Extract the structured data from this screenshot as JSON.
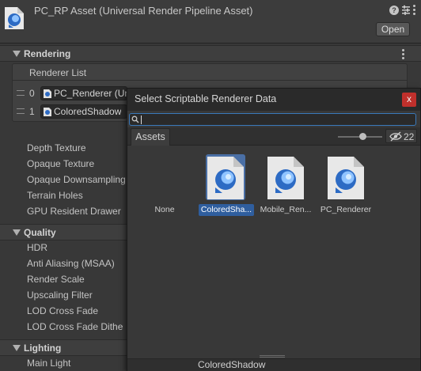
{
  "inspector": {
    "title": "PC_RP Asset (Universal Render Pipeline Asset)",
    "help_icon": "?",
    "open_label": "Open"
  },
  "rendering": {
    "section_label": "Rendering",
    "renderer_list_label": "Renderer List",
    "renderers": [
      {
        "index": "0",
        "name": "PC_Renderer (Un"
      },
      {
        "index": "1",
        "name": "ColoredShadow"
      }
    ],
    "properties": [
      "Depth Texture",
      "Opaque Texture",
      "Opaque Downsampling",
      "Terrain Holes",
      "GPU Resident Drawer"
    ]
  },
  "quality": {
    "section_label": "Quality",
    "properties": [
      "HDR",
      "Anti Aliasing (MSAA)",
      "Render Scale",
      "Upscaling Filter",
      "LOD Cross Fade",
      "LOD Cross Fade Dithe"
    ]
  },
  "lighting": {
    "section_label": "Lighting",
    "properties": [
      "Main Light"
    ]
  },
  "picker": {
    "title": "Select Scriptable Renderer Data",
    "close_label": "x",
    "search_value": "",
    "tab_assets": "Assets",
    "hidden_count": "22",
    "items": [
      {
        "label": "None"
      },
      {
        "label": "ColoredSha..."
      },
      {
        "label": "Mobile_Ren..."
      },
      {
        "label": "PC_Renderer"
      }
    ],
    "selected_item": "ColoredShadow"
  },
  "icons": {
    "asset": "urp-asset-icon",
    "search": "search-icon",
    "hidden_eye": "eye-slash-icon"
  }
}
